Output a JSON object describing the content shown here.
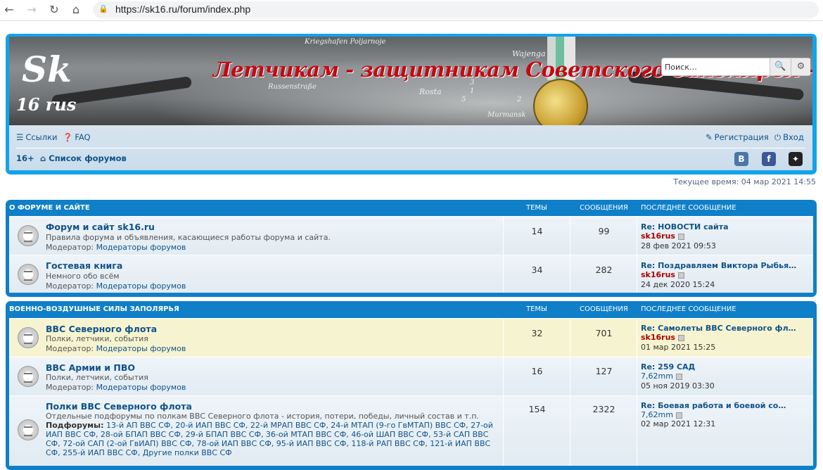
{
  "browser": {
    "back_icon": "←",
    "forward_icon": "→",
    "reload_icon": "↻",
    "home_icon": "⌂",
    "url": "https://sk16.ru/forum/index.php"
  },
  "banner": {
    "title": "Летчикам - защитникам Советского Заполярья - посвящается!",
    "logo_top": "Sk",
    "logo_bottom": "16 rus",
    "map_labels": [
      "Kriegshafen Poljarnoje",
      "Wajenga",
      "Russenstraße",
      "Rosta",
      "Murmansk",
      "1",
      "3",
      "5",
      "2"
    ]
  },
  "search": {
    "placeholder": "Поиск…",
    "search_icon": "🔍",
    "settings_icon": "⚙"
  },
  "nav": {
    "links": "Ссылки",
    "faq": "FAQ",
    "register": "Регистрация",
    "login": "Вход",
    "age": "16+",
    "forum_list": "Список форумов",
    "social": [
      "В",
      "f",
      "✦"
    ]
  },
  "time": "Текущее время: 04 мар 2021 14:55",
  "categories": [
    {
      "title": "О форуме и сайте",
      "col_topics": "Темы",
      "col_posts": "Сообщения",
      "col_last": "Последнее сообщение",
      "forums": [
        {
          "name": "Форум и сайт sk16.ru",
          "desc": "Правила форума и объявления, касающиеся работы форума и сайта.",
          "mod_label": "Модератор:",
          "mod": "Модераторы форумов",
          "topics": "14",
          "posts": "99",
          "last_title": "Re: НОВОСТИ сайта",
          "last_author": "sk16rus",
          "last_date": "28 фев 2021 09:53"
        },
        {
          "name": "Гостевая книга",
          "desc": "Немного обо всём",
          "mod_label": "Модератор:",
          "mod": "Модераторы форумов",
          "topics": "34",
          "posts": "282",
          "last_title": "Re: Поздравляем Виктора Рыбья…",
          "last_author": "sk16rus",
          "last_date": "24 дек 2020 15:24"
        }
      ]
    },
    {
      "title": "Военно-воздушные силы Заполярья",
      "col_topics": "Темы",
      "col_posts": "Сообщения",
      "col_last": "Последнее сообщение",
      "forums": [
        {
          "name": "ВВС Северного флота",
          "desc": "Полки, летчики, события",
          "mod_label": "Модератор:",
          "mod": "Модераторы форумов",
          "topics": "32",
          "posts": "701",
          "last_title": "Re: Самолеты ВВС Северного фл…",
          "last_author": "sk16rus",
          "last_date": "01 мар 2021 15:25"
        },
        {
          "name": "ВВС Армии и ПВО",
          "desc": "Полки, летчики, события",
          "mod_label": "Модератор:",
          "mod": "Модераторы форумов",
          "topics": "16",
          "posts": "127",
          "last_title": "Re: 259 САД",
          "last_author": "7,62mm",
          "last_date": "05 ноя 2019 03:30"
        },
        {
          "name": "Полки ВВС Северного флота",
          "desc": "Отдельные подфорумы по полкам ВВС Северного флота - история, потери, победы, личный состав и т.п.",
          "sub_label": "Подфорумы:",
          "subforums": "13-й АП ВВС СФ, 20-й ИАП ВВС СФ, 22-й МРАП ВВС СФ, 24-й МТАП (9-го ГвМТАП) ВВС СФ, 27-ой ИАП ВВС СФ, 28-ой БПАП ВВС СФ, 29-й БПАП ВВС СФ, 36-ой МТАП ВВС СФ, 46-ой ШАП ВВС СФ, 53-й САП ВВС СФ, 72-ой САП (2-ой ГвИАП) ВВС СФ, 78-ой ИАП ВВС СФ, 95-й ИАП ВВС СФ, 118-й РАП ВВС СФ, 121-й ИАП ВВС СФ, 255-й ИАП ВВС СФ, Другие полки ВВС СФ",
          "topics": "154",
          "posts": "2322",
          "last_title": "Re: Боевая работа и боевой со…",
          "last_author": "7,62mm",
          "last_date": "02 мар 2021 12:31"
        }
      ]
    }
  ]
}
